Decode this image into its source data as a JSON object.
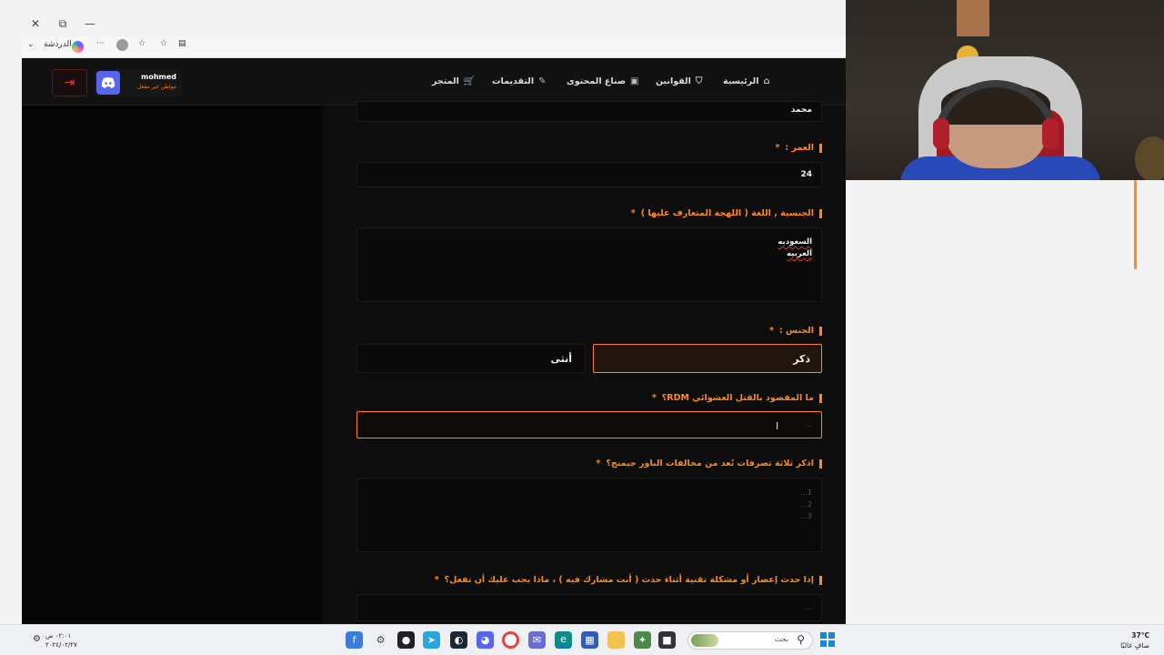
{
  "browser": {
    "close_glyph": "✕",
    "restore_glyph": "⧉",
    "minimize_glyph": "—",
    "chat_label": "الدردشة",
    "more_glyph": "···"
  },
  "nav": {
    "user": {
      "name": "mohmed",
      "role": "مواطن غير مفعل"
    },
    "items": [
      {
        "label": "المتجر",
        "icon": "cart-icon"
      },
      {
        "label": "التقديمات",
        "icon": "edit-icon"
      },
      {
        "label": "صناع المحتوى",
        "icon": "video-icon"
      },
      {
        "label": "القوانين",
        "icon": "shield-icon"
      },
      {
        "label": "الرئيسية",
        "icon": "home-icon"
      }
    ]
  },
  "form": {
    "name_value": "محمد",
    "age": {
      "label": "العمر :",
      "required": "*",
      "value": "24"
    },
    "nationality": {
      "label": "الجنسية , اللغة ( اللهجة المتعارف عليها )",
      "required": "*",
      "lines": [
        "السعوديه",
        "العربيه"
      ]
    },
    "gender": {
      "label": "الجنس :",
      "required": "*",
      "options": [
        "ذكر",
        "أنثى"
      ],
      "selected": "ذكر"
    },
    "rdm": {
      "label": "ما المقصود بالقتل العشوائي RDM؟",
      "required": "*",
      "placeholder": "..."
    },
    "powergaming": {
      "label": "اذكر ثلاثة تصرفات تُعد من مخالفات الباور جيمنج؟",
      "required": "*",
      "placeholder_lines": [
        "1...",
        "2...",
        "3..."
      ]
    },
    "crash": {
      "label": "إذا حدث إعصار أو مشكلة تقنية أثناء حدث ( أنت مشارك فيه ) ، ماذا يجب عليك أن تفعل؟",
      "required": "*",
      "placeholder": "..."
    }
  },
  "taskbar": {
    "search_placeholder": "بحث",
    "temperature": "37°C",
    "weather": "صافٍ غالبًا",
    "time": "٠٢:٠١ ص",
    "date": "٢٠٢٤/٠٢/٢٧"
  },
  "colors": {
    "accent": "#ff8a1f",
    "background": "#0b0b0b",
    "discord": "#5865f2",
    "logout": "#e53935"
  }
}
